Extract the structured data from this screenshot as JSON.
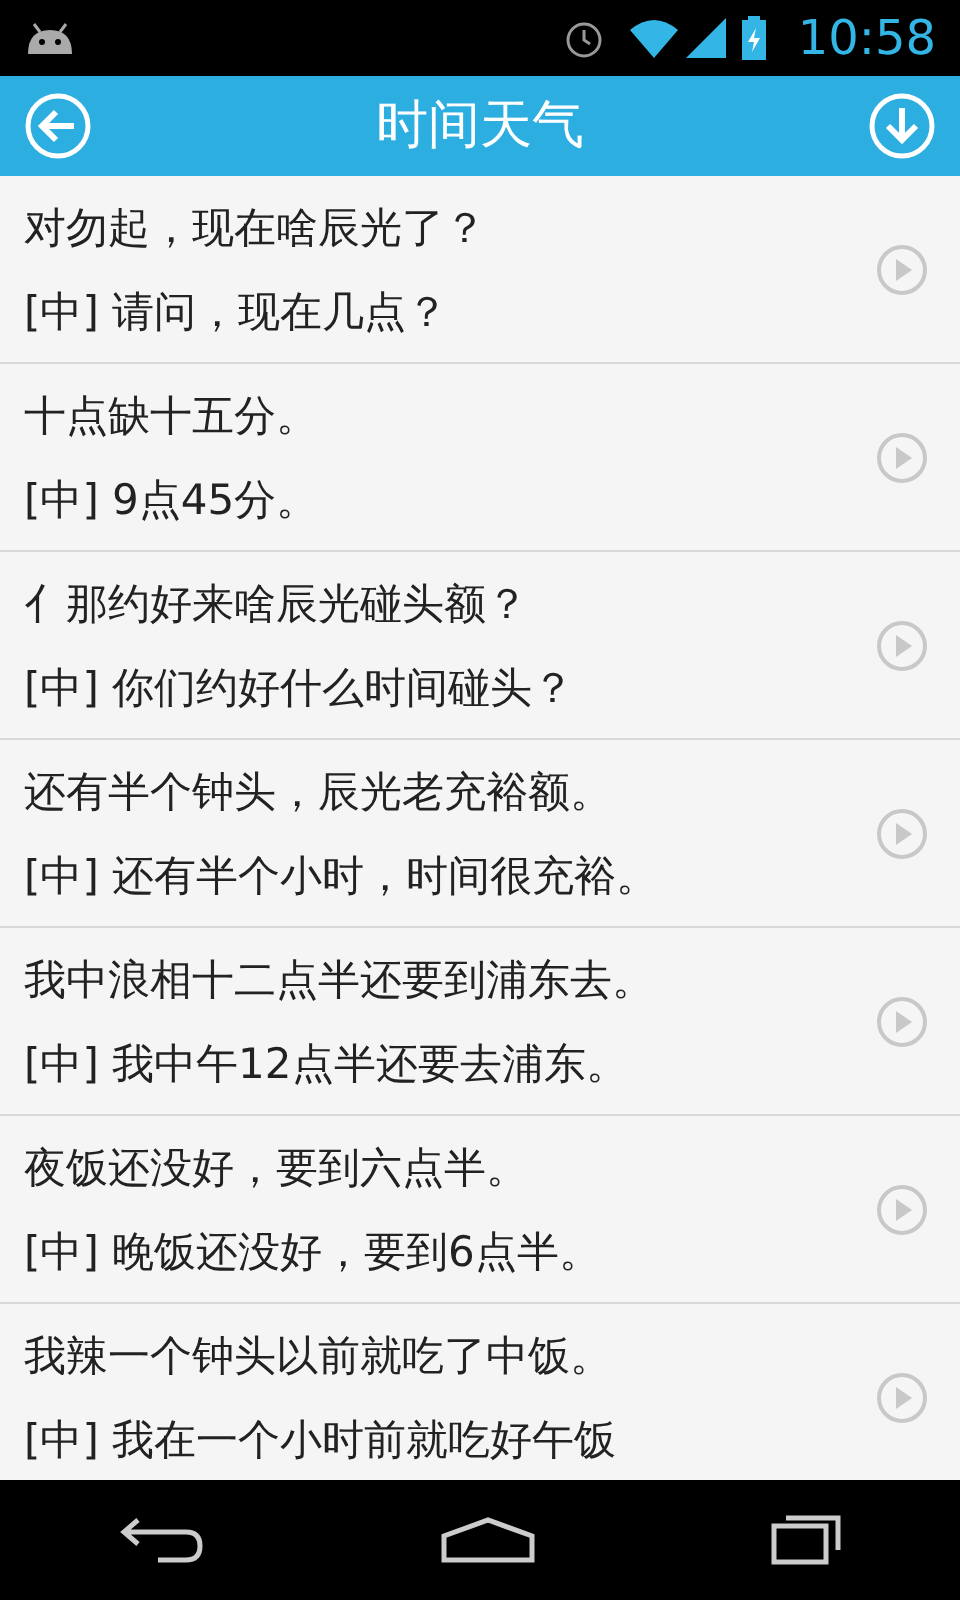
{
  "status_bar": {
    "time": "10:58"
  },
  "header": {
    "title": "时间天气"
  },
  "phrases": [
    {
      "dialect": "对勿起，现在啥辰光了？",
      "mandarin": "[中] 请问，现在几点？"
    },
    {
      "dialect": "十点缺十五分。",
      "mandarin": "[中] 9点45分。"
    },
    {
      "dialect": "亻那约好来啥辰光碰头额？",
      "mandarin": "[中] 你们约好什么时间碰头？"
    },
    {
      "dialect": "还有半个钟头，辰光老充裕额。",
      "mandarin": "[中] 还有半个小时，时间很充裕。"
    },
    {
      "dialect": "我中浪相十二点半还要到浦东去。",
      "mandarin": "[中] 我中午12点半还要去浦东。"
    },
    {
      "dialect": "夜饭还没好，要到六点半。",
      "mandarin": "[中] 晚饭还没好，要到6点半。"
    },
    {
      "dialect": "我辣一个钟头以前就吃了中饭。",
      "mandarin": "[中] 我在一个小时前就吃好午饭"
    }
  ]
}
